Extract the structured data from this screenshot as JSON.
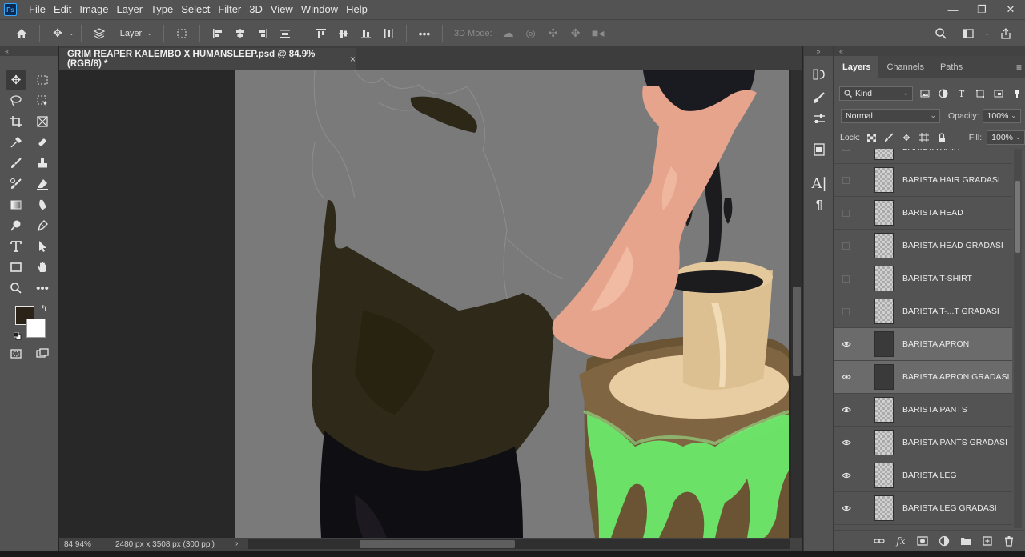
{
  "app": {
    "logo": "Ps"
  },
  "menu": [
    "File",
    "Edit",
    "Image",
    "Layer",
    "Type",
    "Select",
    "Filter",
    "3D",
    "View",
    "Window",
    "Help"
  ],
  "window_controls": {
    "minimize": "—",
    "restore": "❐",
    "close": "✕"
  },
  "options_bar": {
    "auto_select_value": "Layer",
    "mode_3d_label": "3D Mode:"
  },
  "document": {
    "tab_title": "GRIM REAPER KALEMBO X HUMANSLEEP.psd @ 84.9% (RGB/8) *",
    "tab_close": "×",
    "zoom": "84.94%",
    "dimensions": "2480 px x 3508 px (300 ppi)",
    "status_arrow": "›"
  },
  "colors": {
    "foreground": "#2b2317",
    "background": "#ffffff",
    "accent": "#31a8ff"
  },
  "panel": {
    "tabs": [
      "Layers",
      "Channels",
      "Paths"
    ],
    "active_tab": "Layers",
    "filter_kind": "Kind",
    "blend_mode": "Normal",
    "opacity_label": "Opacity:",
    "opacity_value": "100%",
    "lock_label": "Lock:",
    "fill_label": "Fill:",
    "fill_value": "100%",
    "layers": [
      {
        "name": "BARISTA HAIR",
        "visible": false,
        "selected": false
      },
      {
        "name": "BARISTA HAIR GRADASI",
        "visible": false,
        "selected": false
      },
      {
        "name": "BARISTA HEAD",
        "visible": false,
        "selected": false
      },
      {
        "name": "BARISTA HEAD GRADASI",
        "visible": false,
        "selected": false
      },
      {
        "name": "BARISTA T-SHIRT",
        "visible": false,
        "selected": false
      },
      {
        "name": "BARISTA T-...T GRADASI",
        "visible": false,
        "selected": false
      },
      {
        "name": "BARISTA APRON",
        "visible": true,
        "selected": true
      },
      {
        "name": "BARISTA APRON GRADASI",
        "visible": true,
        "selected": true
      },
      {
        "name": "BARISTA PANTS",
        "visible": true,
        "selected": false
      },
      {
        "name": "BARISTA PANTS GRADASI",
        "visible": true,
        "selected": false
      },
      {
        "name": "BARISTA LEG",
        "visible": true,
        "selected": false
      },
      {
        "name": "BARISTA LEG GRADASI",
        "visible": true,
        "selected": false
      }
    ]
  }
}
